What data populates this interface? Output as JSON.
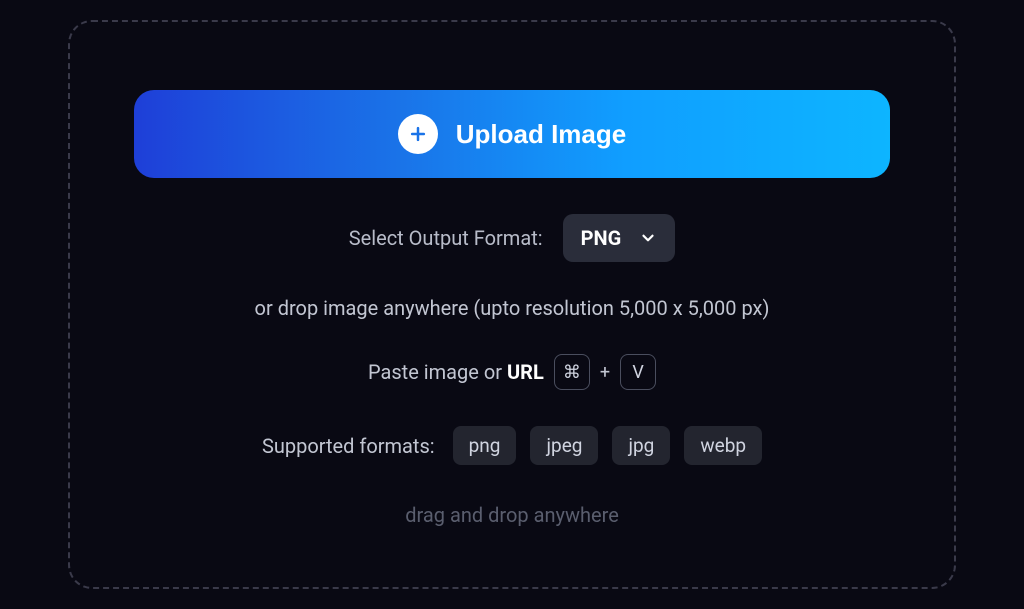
{
  "upload": {
    "button_label": "Upload Image"
  },
  "output_format": {
    "label": "Select Output Format:",
    "selected": "PNG"
  },
  "drop_hint": "or drop image anywhere (upto resolution 5,000 x 5,000 px)",
  "paste": {
    "prefix": "Paste image or ",
    "url_label": "URL",
    "key_modifier": "⌘",
    "key_separator": "+",
    "key_letter": "V"
  },
  "supported": {
    "label": "Supported formats:",
    "formats": [
      "png",
      "jpeg",
      "jpg",
      "webp"
    ]
  },
  "dnd_hint": "drag and drop anywhere"
}
